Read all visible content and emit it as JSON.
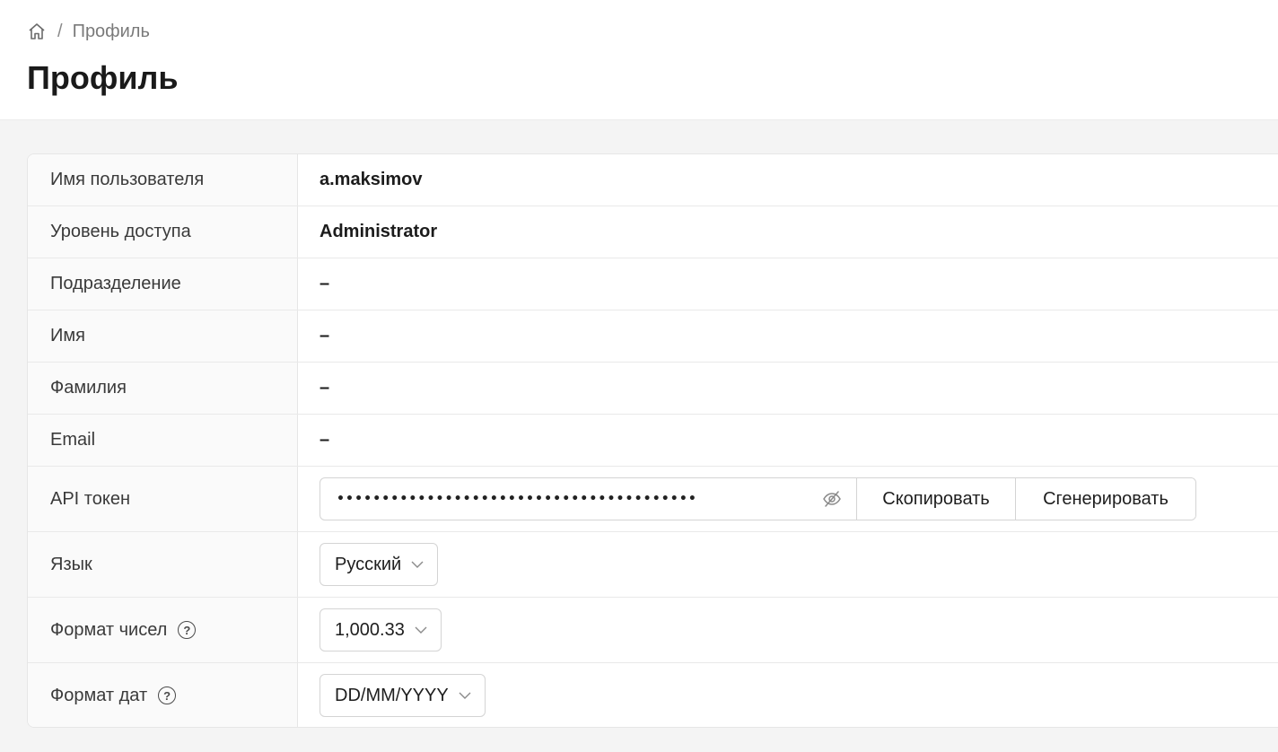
{
  "breadcrumb": {
    "home_icon": "home-icon",
    "separator": "/",
    "current": "Профиль"
  },
  "page": {
    "title": "Профиль"
  },
  "profile": {
    "username_label": "Имя пользователя",
    "username_value": "a.maksimov",
    "access_label": "Уровень доступа",
    "access_value": "Administrator",
    "division_label": "Подразделение",
    "division_value": "–",
    "first_name_label": "Имя",
    "first_name_value": "–",
    "last_name_label": "Фамилия",
    "last_name_value": "–",
    "email_label": "Email",
    "email_value": "–",
    "token_label": "API токен",
    "token_masked": "••••••••••••••••••••••••••••••••••••••••",
    "token_visibility_icon": "eye-slash-icon",
    "copy_button": "Скопировать",
    "generate_button": "Сгенерировать",
    "language_label": "Язык",
    "language_value": "Русский",
    "number_format_label": "Формат чисел",
    "number_format_value": "1,000.33",
    "date_format_label": "Формат дат",
    "date_format_value": "DD/MM/YYYY",
    "help_icon": "question-circle-icon",
    "help_glyph": "?",
    "dropdown_icon": "chevron-down-icon"
  },
  "colors": {
    "page_background": "#f4f4f4",
    "card_background": "#ffffff",
    "label_background": "#fafafa",
    "border": "#e6e6e6",
    "text_primary": "#1c1c1c",
    "text_muted": "#7a7a7a"
  }
}
